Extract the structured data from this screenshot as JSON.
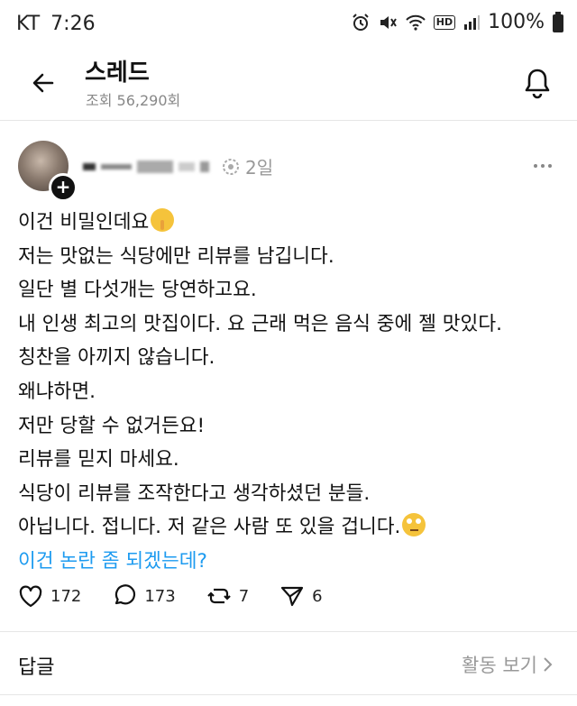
{
  "status_bar": {
    "carrier": "KT",
    "time": "7:26",
    "hd": "HD",
    "battery": "100%",
    "icons": [
      "alarm-icon",
      "mute-icon",
      "wifi-icon",
      "hd-icon",
      "signal-icon",
      "battery-icon"
    ]
  },
  "header": {
    "title": "스레드",
    "subtitle": "조회 56,290회"
  },
  "post": {
    "time_ago": "2일",
    "lines": [
      "이건 비밀인데요",
      "저는 맛없는 식당에만 리뷰를 남깁니다.",
      "일단 별 다섯개는 당연하고요.",
      "내 인생 최고의 맛집이다. 요 근래 먹은 음식 중에 젤 맛있다.",
      "칭찬을 아끼지 않습니다.",
      "왜냐하면.",
      "저만 당할 수 없거든요!",
      "리뷰를 믿지 마세요.",
      "식당이 리뷰를 조작한다고 생각하셨던 분들.",
      "아닙니다. 접니다. 저 같은 사람 또 있을 겁니다."
    ],
    "translate_link": "이건 논란 좀 되겠는데?",
    "likes": "172",
    "comments": "173",
    "reposts": "7",
    "shares": "6"
  },
  "replies": {
    "label": "답글",
    "activity_link": "활동 보기"
  },
  "colors": {
    "link": "#1d9bf0",
    "muted": "#999999"
  }
}
